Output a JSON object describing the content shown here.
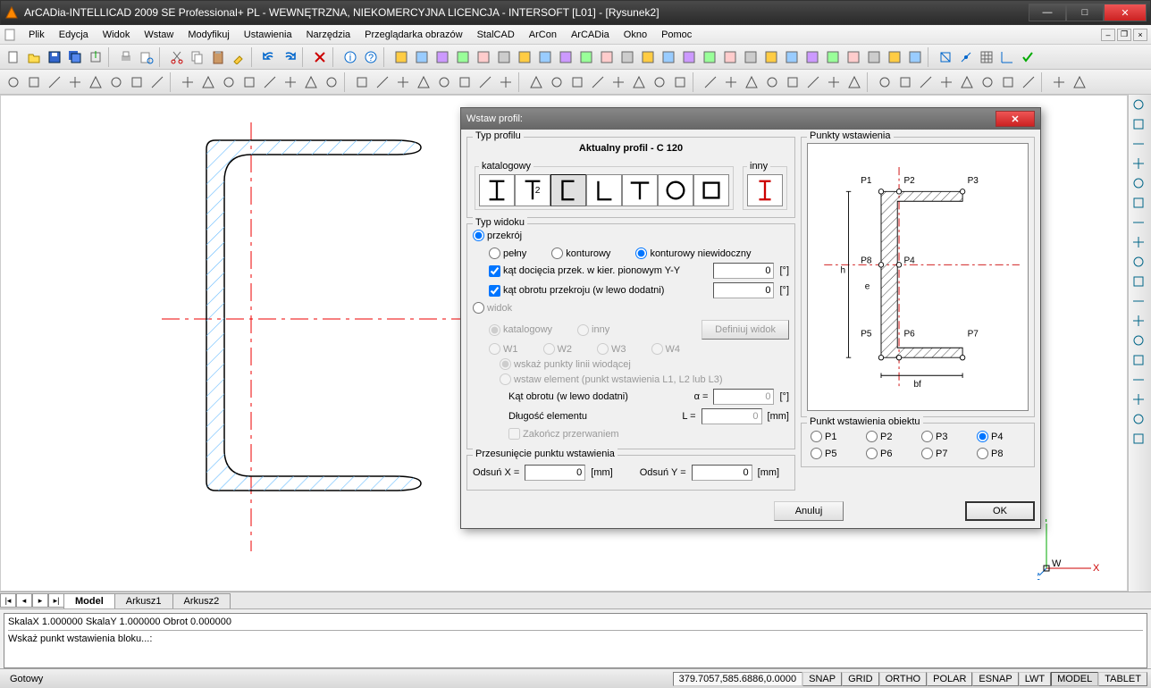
{
  "app": {
    "title": "ArCADia-INTELLICAD 2009 SE Professional+ PL - WEWNĘTRZNA, NIEKOMERCYJNA LICENCJA - INTERSOFT [L01] - [Rysunek2]"
  },
  "menu": {
    "items": [
      "Plik",
      "Edycja",
      "Widok",
      "Wstaw",
      "Modyfikuj",
      "Ustawienia",
      "Narzędzia",
      "Przeglądarka obrazów",
      "StalCAD",
      "ArCon",
      "ArCADia",
      "Okno",
      "Pomoc"
    ]
  },
  "tabs": {
    "model": "Model",
    "sheet1": "Arkusz1",
    "sheet2": "Arkusz2"
  },
  "cmd": {
    "line1": "SkalaX 1.000000 SkalaY 1.000000 Obrot 0.000000",
    "line2": "Wskaż punkt wstawienia bloku...:"
  },
  "status": {
    "ready": "Gotowy",
    "coords": "379.7057,585.6886,0.0000",
    "toggles": [
      "SNAP",
      "GRID",
      "ORTHO",
      "POLAR",
      "ESNAP",
      "LWT",
      "MODEL",
      "TABLET"
    ]
  },
  "dialog": {
    "title": "Wstaw profil:",
    "typ_profilu": {
      "label": "Typ profilu",
      "aktualny": "Aktualny profil - C 120",
      "katalogowy": "katalogowy",
      "inny": "inny"
    },
    "typ_widoku": {
      "label": "Typ widoku",
      "przekroj": "przekrój",
      "pelny": "pełny",
      "konturowy": "konturowy",
      "konturowy_niewid": "konturowy niewidoczny",
      "kat_dociecia": "kąt docięcia przek. w kier. pionowym Y-Y",
      "kat_dociecia_val": "0",
      "kat_dociecia_unit": "[°]",
      "kat_obrotu_przek": "kąt obrotu przekroju (w lewo dodatni)",
      "kat_obrotu_przek_val": "0",
      "kat_obrotu_przek_unit": "[°]",
      "widok": "widok",
      "katalogowy": "katalogowy",
      "inny": "inny",
      "definiuj": "Definiuj widok",
      "w1": "W1",
      "w2": "W2",
      "w3": "W3",
      "w4": "W4",
      "wskaz_punkty": "wskaż punkty linii wiodącej",
      "wstaw_element": "wstaw element (punkt wstawienia L1, L2 lub L3)",
      "kat_obrotu": "Kąt obrotu (w lewo dodatni)",
      "alpha": "α  =",
      "kat_obrotu_val": "0",
      "kat_obrotu_unit": "[°]",
      "dlugosc": "Długość elementu",
      "L": "L =",
      "dlugosc_val": "0",
      "dlugosc_unit": "[mm]",
      "zakoncz": "Zakończ przerwaniem"
    },
    "przesuniecie": {
      "label": "Przesunięcie punktu wstawienia",
      "odsunx": "Odsuń X =",
      "odsunx_val": "0",
      "odsunx_unit": "[mm]",
      "odsuny": "Odsuń Y =",
      "odsuny_val": "0",
      "odsuny_unit": "[mm]"
    },
    "punkty_wstawienia": {
      "label": "Punkty wstawienia",
      "p1": "P1",
      "p2": "P2",
      "p3": "P3",
      "p4": "P4",
      "p5": "P5",
      "p6": "P6",
      "p7": "P7",
      "p8": "P8",
      "h": "h",
      "e": "e",
      "bf": "bf"
    },
    "punkt_obiektu": {
      "label": "Punkt wstawienia obiektu",
      "p1": "P1",
      "p2": "P2",
      "p3": "P3",
      "p4": "P4",
      "p5": "P5",
      "p6": "P6",
      "p7": "P7",
      "p8": "P8"
    },
    "anuluj": "Anuluj",
    "ok": "OK"
  }
}
